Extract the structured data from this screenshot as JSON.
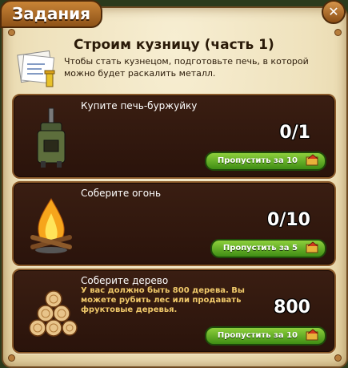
{
  "window": {
    "tab_title": "Задания",
    "close_symbol": "✕"
  },
  "quest": {
    "title": "Строим кузницу (часть 1)",
    "description": "Чтобы стать кузнецом, подготовьте печь, в которой можно будет раскалить металл.",
    "icon": "blueprint-paper-icon"
  },
  "tasks": [
    {
      "title": "Купите печь-буржуйку",
      "subtitle": "",
      "progress": "0/1",
      "skip_label": "Пропустить за 10",
      "icon": "stove-icon"
    },
    {
      "title": "Соберите огонь",
      "subtitle": "",
      "progress": "0/10",
      "skip_label": "Пропустить за 5",
      "icon": "campfire-icon"
    },
    {
      "title": "Соберите дерево",
      "subtitle": "У вас должно быть 800 дерева. Вы можете рубить лес или продавать фруктовые деревья.",
      "progress": "800",
      "skip_label": "Пропустить за 10",
      "icon": "wood-logs-icon"
    }
  ],
  "colors": {
    "card_bg": "#2e160d",
    "accent_green": "#5aa61e",
    "tab_brown": "#a8682a"
  }
}
